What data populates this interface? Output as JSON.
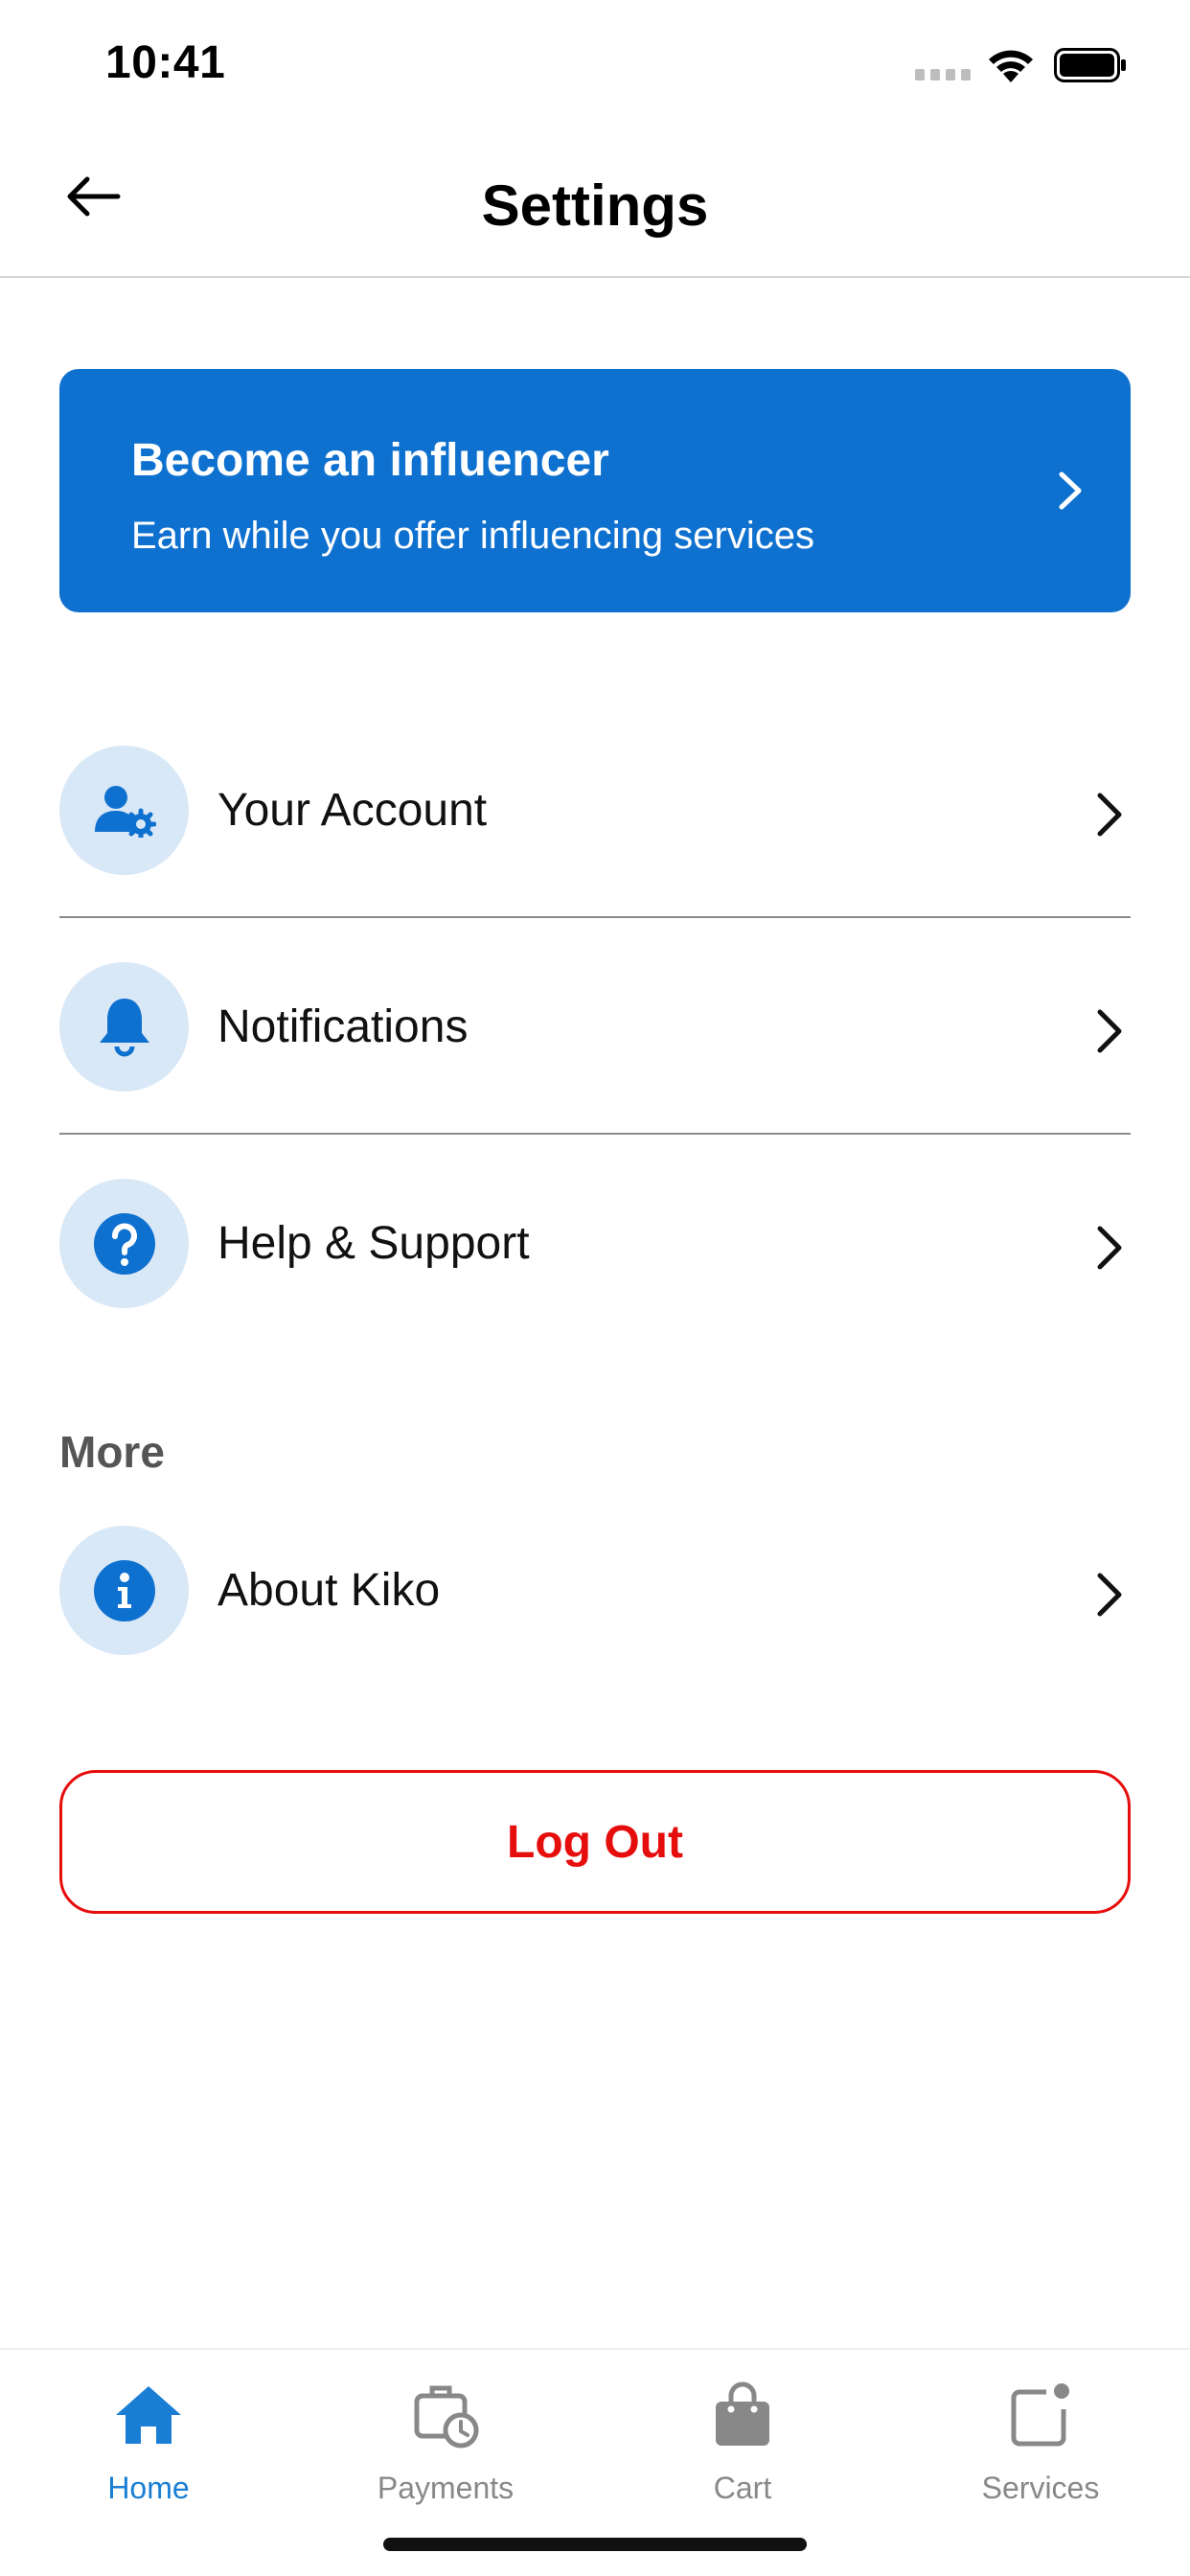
{
  "status_bar": {
    "time": "10:41"
  },
  "nav": {
    "title": "Settings"
  },
  "promo": {
    "title": "Become an influencer",
    "subtitle": "Earn while you offer influencing services",
    "color": "#0f71cf"
  },
  "menu_items": [
    {
      "label": "Your Account",
      "icon": "user-gear-icon"
    },
    {
      "label": "Notifications",
      "icon": "bell-icon"
    },
    {
      "label": "Help & Support",
      "icon": "question-circle-icon"
    }
  ],
  "more_section": {
    "header": "More",
    "items": [
      {
        "label": "About Kiko",
        "icon": "info-circle-icon"
      }
    ]
  },
  "logout": {
    "label": "Log Out",
    "color": "#e60d0d"
  },
  "tab_bar": {
    "active": "Home",
    "active_color": "#1a7fd4",
    "tabs": [
      {
        "label": "Home",
        "icon": "home-icon"
      },
      {
        "label": "Payments",
        "icon": "payments-clock-icon"
      },
      {
        "label": "Cart",
        "icon": "shopping-bag-icon"
      },
      {
        "label": "Services",
        "icon": "services-icon"
      }
    ]
  }
}
